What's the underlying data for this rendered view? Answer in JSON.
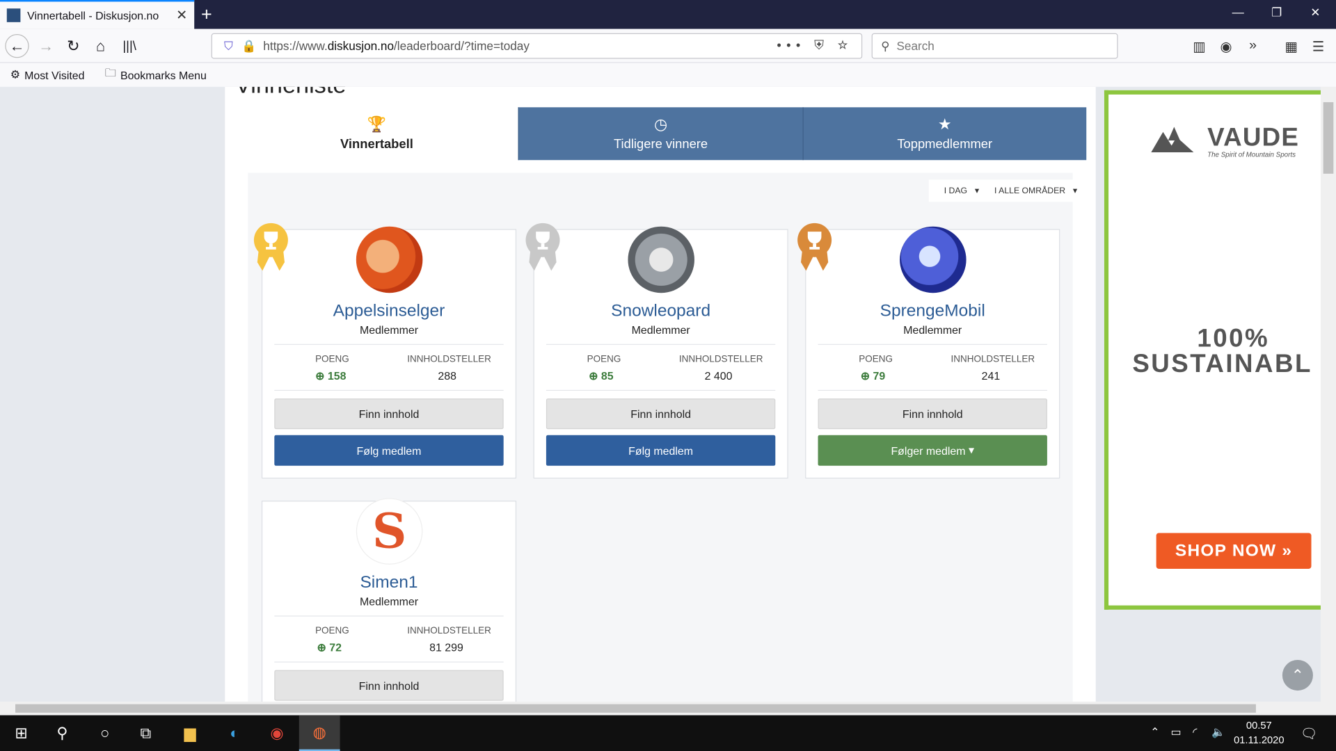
{
  "browser": {
    "tab_title": "Vinnertabell - Diskusjon.no",
    "new_tab": "+",
    "url_prefix": "https://www.",
    "url_host": "diskusjon.no",
    "url_path": "/leaderboard/?time=today",
    "search_placeholder": "Search",
    "bookmarks": [
      "Most Visited",
      "Bookmarks Menu"
    ]
  },
  "page": {
    "heading": "Vinnerliste",
    "tabs": [
      {
        "label": "Vinnertabell",
        "icon": "trophy-icon"
      },
      {
        "label": "Tidligere vinnere",
        "icon": "clock-icon"
      },
      {
        "label": "Toppmedlemmer",
        "icon": "star-icon"
      }
    ],
    "filters": {
      "time": "I DAG",
      "area": "I ALLE OMRÅDER"
    },
    "stat_labels": {
      "points": "POENG",
      "content": "INNHOLDSTELLER"
    },
    "members": [
      {
        "name": "Appelsinselger",
        "role": "Medlemmer",
        "points": "158",
        "content": "288",
        "find": "Finn innhold",
        "follow": "Følg medlem",
        "rank": "gold"
      },
      {
        "name": "Snowleopard",
        "role": "Medlemmer",
        "points": "85",
        "content": "2 400",
        "find": "Finn innhold",
        "follow": "Følg medlem",
        "rank": "silver"
      },
      {
        "name": "SprengeMobil",
        "role": "Medlemmer",
        "points": "79",
        "content": "241",
        "find": "Finn innhold",
        "follow": "Følger medlem",
        "rank": "bronze"
      },
      {
        "name": "Simen1",
        "role": "Medlemmer",
        "points": "72",
        "content": "81 299",
        "find": "Finn innhold",
        "follow": "",
        "rank": "none"
      }
    ]
  },
  "ad": {
    "brand": "VAUDE",
    "tagline": "The Spirit of Mountain Sports",
    "headline1": "100%",
    "headline2": "SUSTAINABL",
    "cta": "SHOP NOW »",
    "border_color": "#8dc63f",
    "cta_color": "#ef5a24"
  },
  "taskbar": {
    "time": "00.57",
    "date": "01.11.2020"
  },
  "colors": {
    "tab_blue": "#4e739f",
    "follow_blue": "#2f5f9e",
    "following_green": "#5a8f52",
    "gold": "#f6c340",
    "silver": "#c8c8c8",
    "bronze": "#d98a3a"
  }
}
